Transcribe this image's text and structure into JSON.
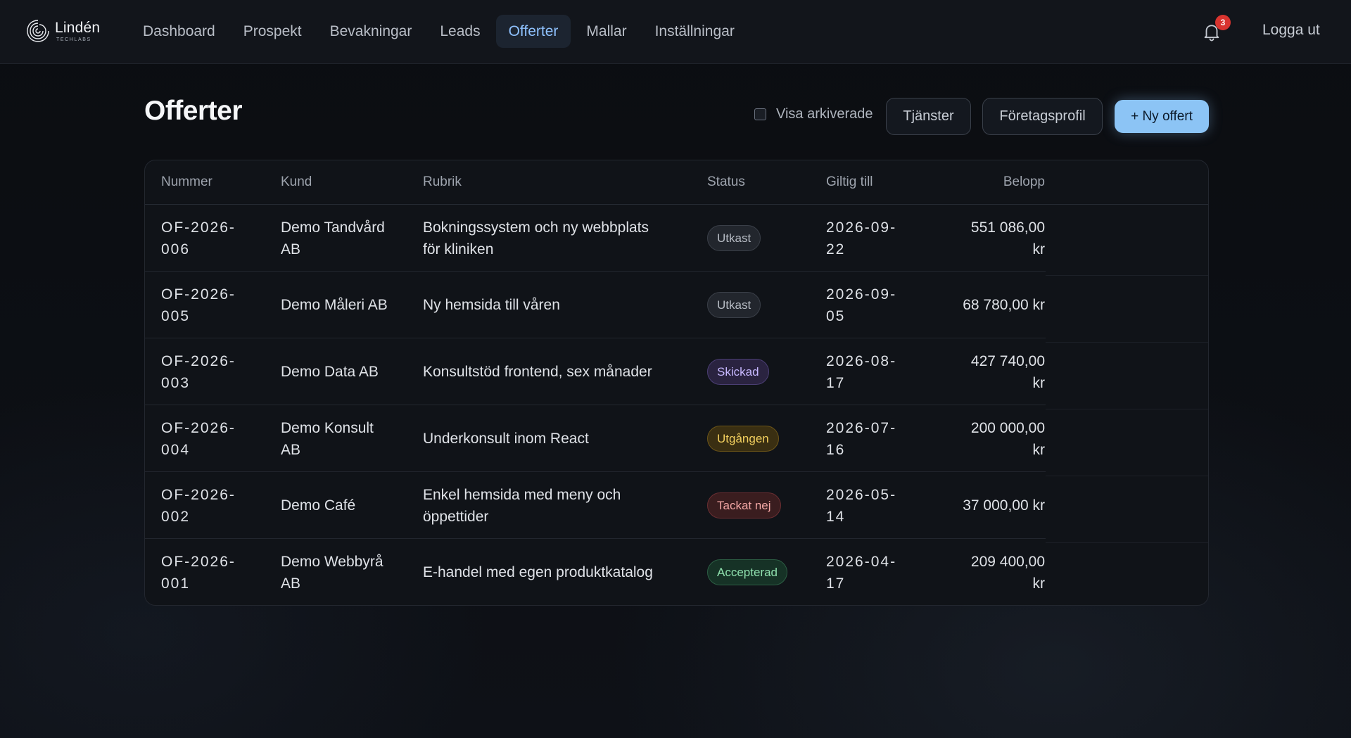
{
  "app": {
    "logo_name": "Lindén",
    "logo_sub": "TECHLABS"
  },
  "nav": {
    "items": [
      {
        "label": "Dashboard",
        "active": false
      },
      {
        "label": "Prospekt",
        "active": false
      },
      {
        "label": "Bevakningar",
        "active": false
      },
      {
        "label": "Leads",
        "active": false
      },
      {
        "label": "Offerter",
        "active": true
      },
      {
        "label": "Mallar",
        "active": false
      },
      {
        "label": "Inställningar",
        "active": false
      }
    ],
    "notification_count": "3",
    "notification_icon": "bell-icon",
    "logout_label": "Logga ut"
  },
  "page": {
    "title": "Offerter",
    "show_archived_label": "Visa arkiverade",
    "show_archived_checked": false,
    "services_button": "Tjänster",
    "profile_button": "Företagsprofil",
    "new_offer_button": "+ Ny offert"
  },
  "table": {
    "columns": [
      "Nummer",
      "Kund",
      "Rubrik",
      "Status",
      "Giltig till",
      "Belopp"
    ],
    "rows": [
      {
        "number": [
          "OF-2026-",
          "006"
        ],
        "customer": [
          "Demo Tandvård",
          "AB"
        ],
        "subject": [
          "Bokningssystem och ny webbplats",
          "för kliniken"
        ],
        "status": "Utkast",
        "status_kind": "draft",
        "valid_until": [
          "2026-09-",
          "22"
        ],
        "amount": [
          "551 086,00",
          "kr"
        ]
      },
      {
        "number": [
          "OF-2026-",
          "005"
        ],
        "customer": [
          "Demo Måleri AB"
        ],
        "subject": [
          "Ny hemsida till våren"
        ],
        "status": "Utkast",
        "status_kind": "draft",
        "valid_until": [
          "2026-09-",
          "05"
        ],
        "amount": [
          "68 780,00 kr"
        ]
      },
      {
        "number": [
          "OF-2026-",
          "003"
        ],
        "customer": [
          "Demo Data AB"
        ],
        "subject": [
          "Konsultstöd frontend, sex månader"
        ],
        "status": "Skickad",
        "status_kind": "sent",
        "valid_until": [
          "2026-08-",
          "17"
        ],
        "amount": [
          "427 740,00",
          "kr"
        ]
      },
      {
        "number": [
          "OF-2026-",
          "004"
        ],
        "customer": [
          "Demo Konsult",
          "AB"
        ],
        "subject": [
          "Underkonsult inom React"
        ],
        "status": "Utgången",
        "status_kind": "expired",
        "valid_until": [
          "2026-07-",
          "16"
        ],
        "amount": [
          "200 000,00",
          "kr"
        ]
      },
      {
        "number": [
          "OF-2026-",
          "002"
        ],
        "customer": [
          "Demo Café"
        ],
        "subject": [
          "Enkel hemsida med meny och",
          "öppettider"
        ],
        "status": "Tackat nej",
        "status_kind": "declined",
        "valid_until": [
          "2026-05-",
          "14"
        ],
        "amount": [
          "37 000,00 kr"
        ]
      },
      {
        "number": [
          "OF-2026-",
          "001"
        ],
        "customer": [
          "Demo Webbyrå",
          "AB"
        ],
        "subject": [
          "E-handel med egen produktkatalog"
        ],
        "status": "Accepterad",
        "status_kind": "accepted",
        "valid_until": [
          "2026-04-",
          "17"
        ],
        "amount": [
          "209 400,00",
          "kr"
        ]
      }
    ]
  }
}
